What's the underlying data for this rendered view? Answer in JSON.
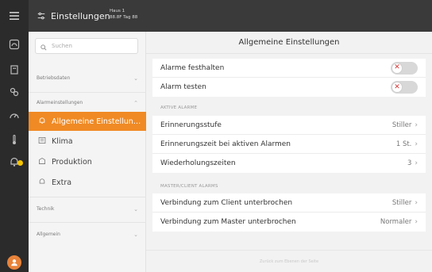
{
  "header": {
    "title": "Einstellungen",
    "house_line1": "Haus 1",
    "house_line2": "88.8F Tag 88"
  },
  "sidebar": {
    "search_placeholder": "Suchen",
    "sections": [
      {
        "label": "Betriebsdaten"
      },
      {
        "label": "Alarmeinstellungen"
      }
    ],
    "items": [
      {
        "label": "Allgemeine Einstellungen",
        "active": true
      },
      {
        "label": "Klima"
      },
      {
        "label": "Produktion"
      },
      {
        "label": "Extra"
      }
    ],
    "bottom_sections": [
      {
        "label": "Technik"
      },
      {
        "label": "Allgemein"
      }
    ]
  },
  "main": {
    "title": "Allgemeine Einstellungen",
    "toggles": [
      {
        "label": "Alarme festhalten",
        "state": "off"
      },
      {
        "label": "Alarm testen",
        "state": "off"
      }
    ],
    "active_alarms": {
      "heading": "AKTIVE ALARME",
      "rows": [
        {
          "label": "Erinnerungsstufe",
          "value": "Stiller"
        },
        {
          "label": "Erinnerungszeit bei aktiven Alarmen",
          "value": "1 St."
        },
        {
          "label": "Wiederholungszeiten",
          "value": "3"
        }
      ]
    },
    "master_client": {
      "heading": "MASTER/CLIENT ALARMS",
      "rows": [
        {
          "label": "Verbindung zum Client unterbrochen",
          "value": "Stiller"
        },
        {
          "label": "Verbindung zum Master unterbrochen",
          "value": "Normaler"
        }
      ]
    },
    "footer": "Zurück zum Ebenen der Seite"
  },
  "colors": {
    "accent": "#f08a24",
    "rail": "#2b2b2b",
    "topbar": "#3a3a3a",
    "toggle_x": "#d23a3a",
    "notification": "#f5c400"
  },
  "icons": {
    "rail": [
      "menu-icon",
      "dashboard-icon",
      "building-icon",
      "sliders-icon",
      "gauge-icon",
      "thermometer-icon",
      "bell-icon",
      "user-avatar-icon"
    ],
    "header": "settings-sliders-icon",
    "search": "search-icon",
    "nav": [
      "bell-icon",
      "climate-icon",
      "production-icon",
      "extra-icon"
    ]
  }
}
